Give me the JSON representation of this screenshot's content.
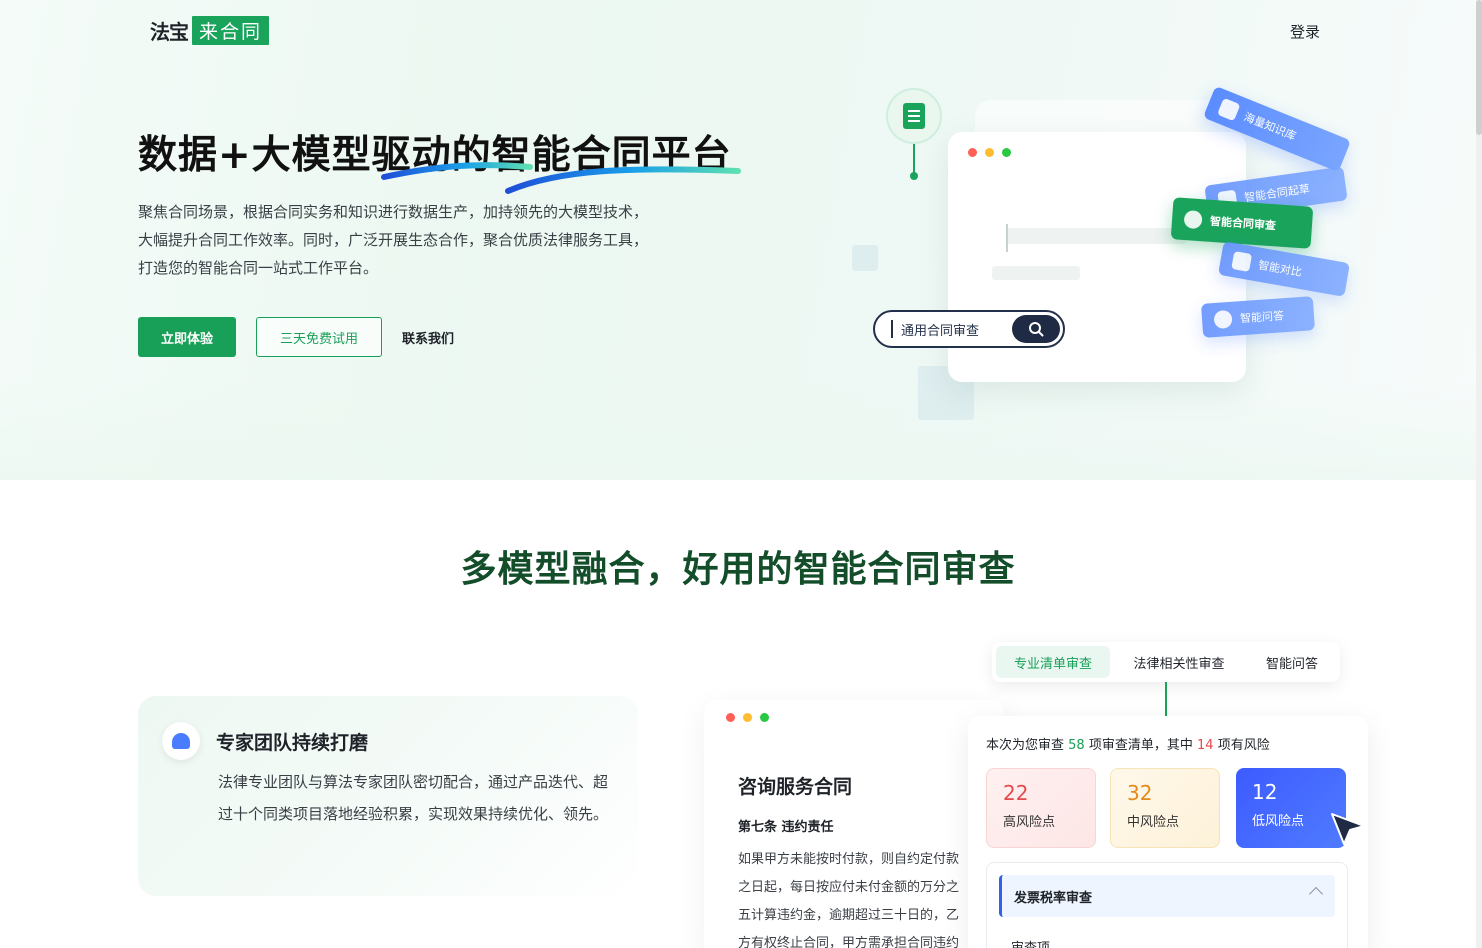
{
  "header": {
    "logo_left": "法宝",
    "logo_right": "来合同",
    "login_label": "登录"
  },
  "hero": {
    "title": "数据+大模型驱动的智能合同平台",
    "description": "聚焦合同场景，根据合同实务和知识进行数据生产，加持领先的大模型技术，大幅提升合同工作效率。同时，广泛开展生态合作，聚合优质法律服务工具，打造您的智能合同一站式工作平台。",
    "primary_button": "立即体验",
    "trial_button": "三天免费试用",
    "contact_link": "联系我们",
    "illustration": {
      "search_text": "通用合同审查",
      "tags": [
        "海量知识库",
        "智能合同起草",
        "智能合同审查",
        "智能对比",
        "智能问答"
      ]
    }
  },
  "section_review": {
    "title": "多模型融合，好用的智能合同审查",
    "expert_card": {
      "title": "专家团队持续打磨",
      "description": "法律专业团队与算法专家团队密切配合，通过产品迭代、超过十个同类项目落地经验积累，实现效果持续优化、领先。"
    },
    "tabs": [
      "专业清单审查",
      "法律相关性审查",
      "智能问答"
    ],
    "active_tab": "专业清单审查",
    "document": {
      "title": "咨询服务合同",
      "clause": "第七条 违约责任",
      "lines": [
        "如果甲方未能按时付款，则自约定付款",
        "之日起，每日按应付未付金额的万分之",
        "五计算违约金，逾期超过三十日的，乙",
        "方有权终止合同，甲方需承担合同违约"
      ]
    },
    "risk_panel": {
      "summary_prefix": "本次为您审查",
      "total_items": "58",
      "summary_mid": "项审查清单，其中",
      "risk_items": "14",
      "summary_suffix": "项有风险",
      "high": {
        "count": "22",
        "label": "高风险点"
      },
      "mid": {
        "count": "32",
        "label": "中风险点"
      },
      "low": {
        "count": "12",
        "label": "低风险点"
      },
      "review_section_title": "发票税率审查",
      "review_item_label": "审查项"
    }
  },
  "colors": {
    "brand_green": "#18a058",
    "title_dark_green": "#134d2a",
    "risk_high": "#e5484d",
    "risk_mid": "#e58a1a",
    "risk_low": "#3d5bff"
  }
}
